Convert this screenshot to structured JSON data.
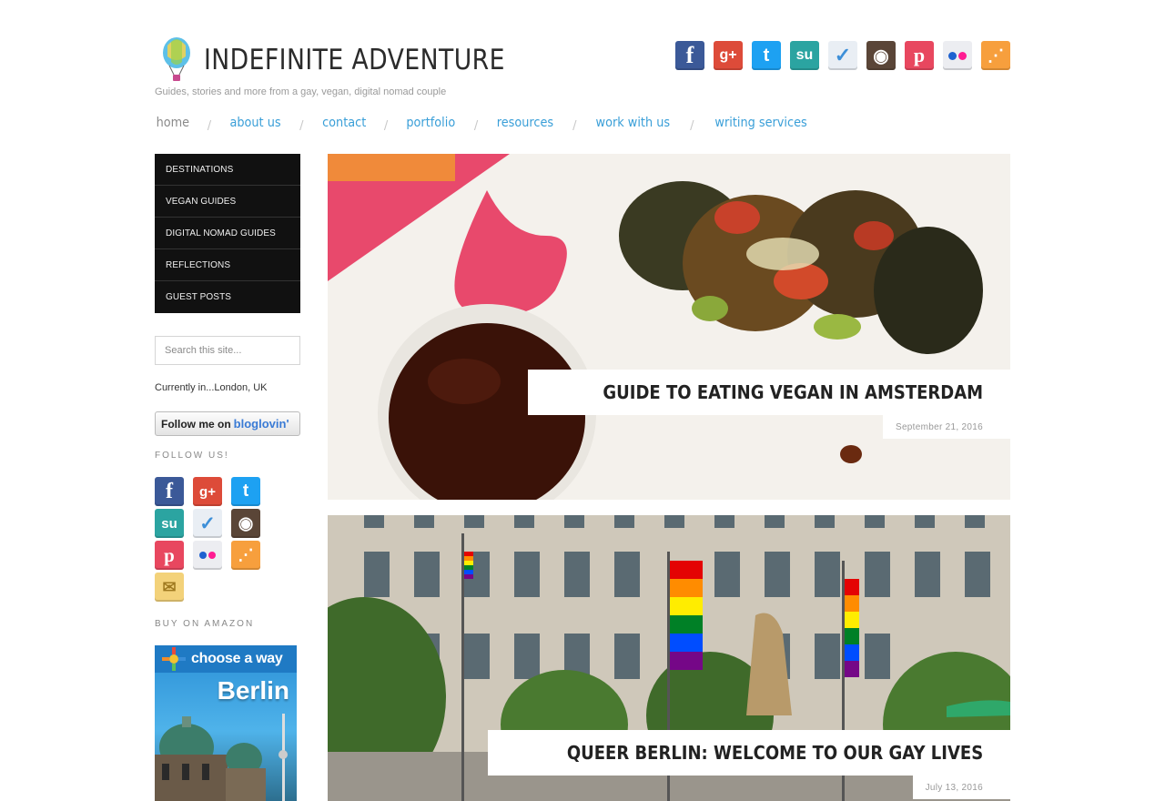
{
  "site": {
    "title": "INDEFINITE ADVENTURE",
    "tagline": "Guides, stories and more from a gay, vegan, digital nomad couple"
  },
  "social_top": [
    {
      "name": "facebook",
      "glyph": "f",
      "color": "#3b5998"
    },
    {
      "name": "googleplus",
      "glyph": "g+",
      "color": "#dd4b39"
    },
    {
      "name": "twitter",
      "glyph": "t",
      "color": "#1da1f2"
    },
    {
      "name": "stumbleupon",
      "glyph": "su",
      "color": "#2ba4a1"
    },
    {
      "name": "foursquare",
      "glyph": "✓",
      "color": "#3d8fd8"
    },
    {
      "name": "instagram",
      "glyph": "◉",
      "color": "#5a4537"
    },
    {
      "name": "pinterest",
      "glyph": "p",
      "color": "#e8475f"
    },
    {
      "name": "flickr",
      "glyph": "••",
      "color": "#e9e9ee"
    },
    {
      "name": "rss",
      "glyph": "⋰",
      "color": "#f79f3d"
    }
  ],
  "nav": {
    "items": [
      "home",
      "about us",
      "contact",
      "portfolio",
      "resources",
      "work with us",
      "writing services"
    ]
  },
  "categories": [
    "DESTINATIONS",
    "VEGAN GUIDES",
    "DIGITAL NOMAD GUIDES",
    "REFLECTIONS",
    "GUEST POSTS"
  ],
  "search": {
    "placeholder": "Search this site..."
  },
  "currently": "Currently in...London, UK",
  "bloglovin": {
    "prefix": "Follow me on",
    "brand": "bloglovin'"
  },
  "follow_title": "FOLLOW US!",
  "amazon_title": "BUY ON AMAZON",
  "book": {
    "banner": "choose a way",
    "city": "Berlin"
  },
  "posts": [
    {
      "title": "GUIDE TO EATING VEGAN IN AMSTERDAM",
      "date": "September 21, 2016"
    },
    {
      "title": "QUEER BERLIN: WELCOME TO OUR GAY LIVES",
      "date": "July 13, 2016"
    }
  ]
}
